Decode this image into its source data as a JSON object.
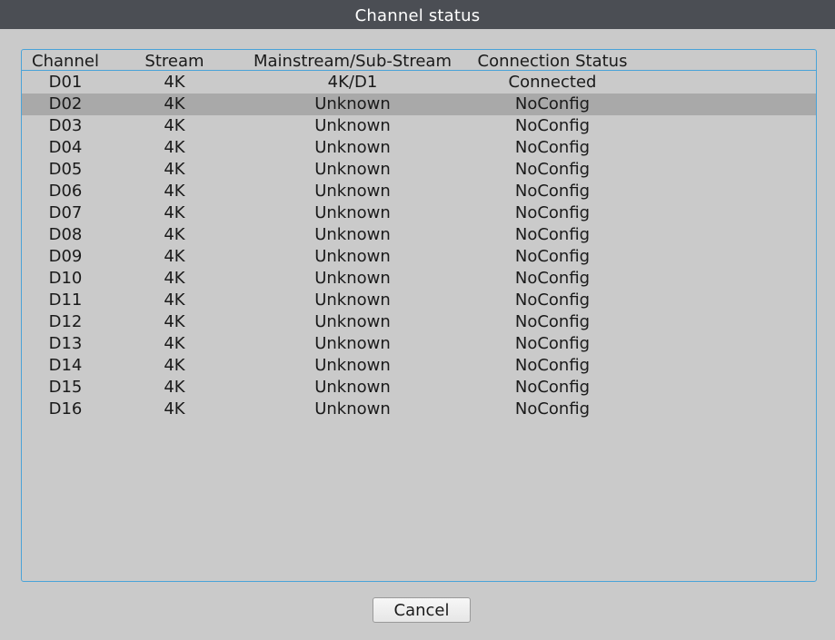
{
  "window": {
    "title": "Channel status"
  },
  "table": {
    "columns": [
      "Channel",
      "Stream",
      "Mainstream/Sub-Stream",
      "Connection Status"
    ],
    "selected_row": 1,
    "rows": [
      [
        "D01",
        "4K",
        "4K/D1",
        "Connected"
      ],
      [
        "D02",
        "4K",
        "Unknown",
        "NoConfig"
      ],
      [
        "D03",
        "4K",
        "Unknown",
        "NoConfig"
      ],
      [
        "D04",
        "4K",
        "Unknown",
        "NoConfig"
      ],
      [
        "D05",
        "4K",
        "Unknown",
        "NoConfig"
      ],
      [
        "D06",
        "4K",
        "Unknown",
        "NoConfig"
      ],
      [
        "D07",
        "4K",
        "Unknown",
        "NoConfig"
      ],
      [
        "D08",
        "4K",
        "Unknown",
        "NoConfig"
      ],
      [
        "D09",
        "4K",
        "Unknown",
        "NoConfig"
      ],
      [
        "D10",
        "4K",
        "Unknown",
        "NoConfig"
      ],
      [
        "D11",
        "4K",
        "Unknown",
        "NoConfig"
      ],
      [
        "D12",
        "4K",
        "Unknown",
        "NoConfig"
      ],
      [
        "D13",
        "4K",
        "Unknown",
        "NoConfig"
      ],
      [
        "D14",
        "4K",
        "Unknown",
        "NoConfig"
      ],
      [
        "D15",
        "4K",
        "Unknown",
        "NoConfig"
      ],
      [
        "D16",
        "4K",
        "Unknown",
        "NoConfig"
      ]
    ]
  },
  "footer": {
    "cancel_label": "Cancel"
  },
  "colors": {
    "titlebar_bg": "#4b4e54",
    "background": "#cacaca",
    "frame_border": "#4aa3d8",
    "selected_row_bg": "#a9a9a9"
  }
}
